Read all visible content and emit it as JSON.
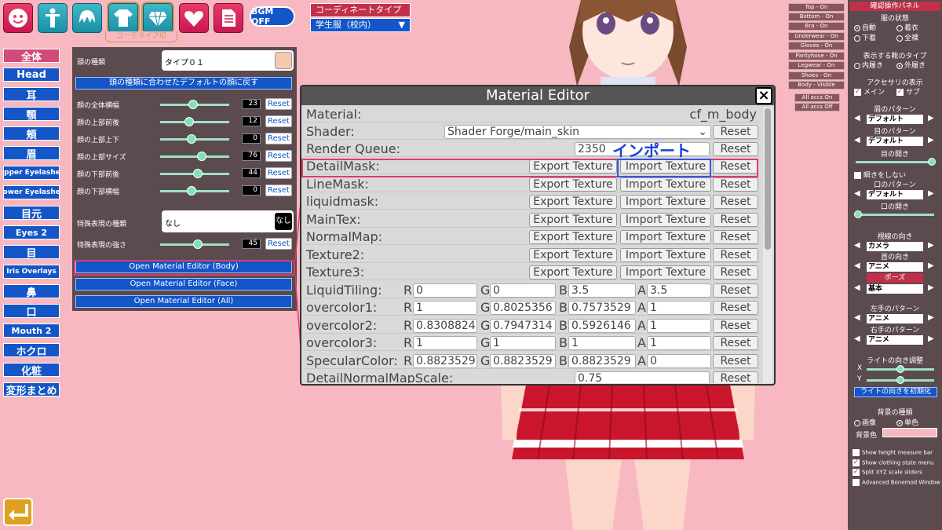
{
  "topbar": {
    "bgm_label": "BGM OFF",
    "coord_label": "コーデタイプ切",
    "coord_type_label": "コーディネートタイプ",
    "coord_type_value": "学生服（校内）"
  },
  "categories": [
    "全体",
    "Head",
    "耳",
    "顎",
    "頬",
    "眉",
    "Upper Eyelashes",
    "Lower Eyelashes",
    "目元",
    "Eyes 2",
    "目",
    "Iris Overlays",
    "鼻",
    "口",
    "Mouth 2",
    "ホクロ",
    "化粧",
    "変形まとめ"
  ],
  "face_panel": {
    "head_type_label": "頭の種類",
    "head_type_value": "タイプ０１",
    "default_face_button": "頭の種類に合わせたデフォルトの顔に戻す",
    "sliders": [
      {
        "label": "顔の全体横幅",
        "value": "23",
        "pos": 0.48
      },
      {
        "label": "顔の上部前後",
        "value": "12",
        "pos": 0.42
      },
      {
        "label": "顔の上部上下",
        "value": "0",
        "pos": 0.45
      },
      {
        "label": "顔の上部サイズ",
        "value": "76",
        "pos": 0.6
      },
      {
        "label": "顔の下部前後",
        "value": "44",
        "pos": 0.55
      },
      {
        "label": "顔の下部横幅",
        "value": "0",
        "pos": 0.45
      }
    ],
    "special_type_label": "特殊表現の種類",
    "special_type_value": "なし",
    "special_type_badge": "なし",
    "special_strength": {
      "label": "特殊表現の強さ",
      "value": "45",
      "pos": 0.55
    },
    "reset_label": "Reset",
    "open_body": "Open Material Editor (Body)",
    "open_face": "Open Material Editor (Face)",
    "open_all": "Open Material Editor (All)"
  },
  "toggles": [
    "Top - On",
    "Bottom - On",
    "Bra - On",
    "Underwear - On",
    "Gloves - On",
    "Pantyhose - On",
    "Legwear - On",
    "Shoes - On",
    "Body - Visible",
    "All accs On",
    "All accs Off"
  ],
  "material_editor": {
    "title": "Material Editor",
    "material_label": "Material:",
    "material_value": "cf_m_body",
    "shader_label": "Shader:",
    "shader_value": "Shader Forge/main_skin",
    "render_queue_label": "Render Queue:",
    "render_queue_value": "2350",
    "export_label": "Export Texture",
    "import_label": "Import Texture",
    "reset_label": "Reset",
    "texture_rows": [
      "DetailMask:",
      "LineMask:",
      "liquidmask:",
      "MainTex:",
      "NormalMap:",
      "Texture2:",
      "Texture3:"
    ],
    "color_rows": [
      {
        "name": "LiquidTiling:",
        "r": "0",
        "g": "0",
        "b": "3.5",
        "a": "3.5"
      },
      {
        "name": "overcolor1:",
        "r": "1",
        "g": "0.8025356",
        "b": "0.7573529",
        "a": "1"
      },
      {
        "name": "overcolor2:",
        "r": "0.8308824",
        "g": "0.7947314",
        "b": "0.5926146",
        "a": "1"
      },
      {
        "name": "overcolor3:",
        "r": "1",
        "g": "1",
        "b": "1",
        "a": "1"
      },
      {
        "name": "SpecularColor:",
        "r": "0.8823529",
        "g": "0.8823529",
        "b": "0.8823529",
        "a": "0"
      }
    ],
    "last_row_name": "DetailNormalMapScale:",
    "last_row_value": "0.75",
    "letters": {
      "r": "R",
      "g": "G",
      "b": "B",
      "a": "A"
    }
  },
  "import_annotation": "インポート",
  "right_panel": {
    "title": "確認操作パネル",
    "cloth_state_label": "服の状態",
    "cloth_state_options": [
      "自動",
      "着衣",
      "下着",
      "全裸"
    ],
    "shoe_type_label": "表示する靴のタイプ",
    "shoe_options": [
      "内履き",
      "外履き"
    ],
    "acc_label": "アクセサリの表示",
    "acc_options": [
      "メイン",
      "サブ"
    ],
    "eyebrow_pattern_label": "眉のパターン",
    "eyebrow_pattern_value": "デフォルト",
    "eye_pattern_label": "目のパターン",
    "eye_pattern_value": "デフォルト",
    "eye_open_label": "目の開き",
    "no_blink_label": "瞬きをしない",
    "mouth_pattern_label": "口のパターン",
    "mouth_pattern_value": "デフォルト",
    "mouth_open_label": "口の開き",
    "gaze_label": "視線の向き",
    "gaze_value": "カメラ",
    "neck_label": "首の向き",
    "neck_value": "アニメ",
    "pose_label": "ポーズ",
    "pose_value": "基本",
    "left_hand_label": "左手のパターン",
    "left_hand_value": "アニメ",
    "right_hand_label": "右手のパターン",
    "right_hand_value": "アニメ",
    "light_label": "ライトの向き調整",
    "light_x": "X",
    "light_y": "Y",
    "light_reset": "ライトの向きを初期化",
    "bg_label": "背景の種類",
    "bg_options": [
      "画像",
      "単色"
    ],
    "bg_color_label": "背景色",
    "bg_color": "#f7b8c1",
    "checks": [
      {
        "label": "Show height measure bar",
        "on": false
      },
      {
        "label": "Show clothing state menu",
        "on": true
      },
      {
        "label": "Split XYZ scale sliders",
        "on": true
      },
      {
        "label": "Advanced Bonemod Window",
        "on": false
      }
    ]
  }
}
